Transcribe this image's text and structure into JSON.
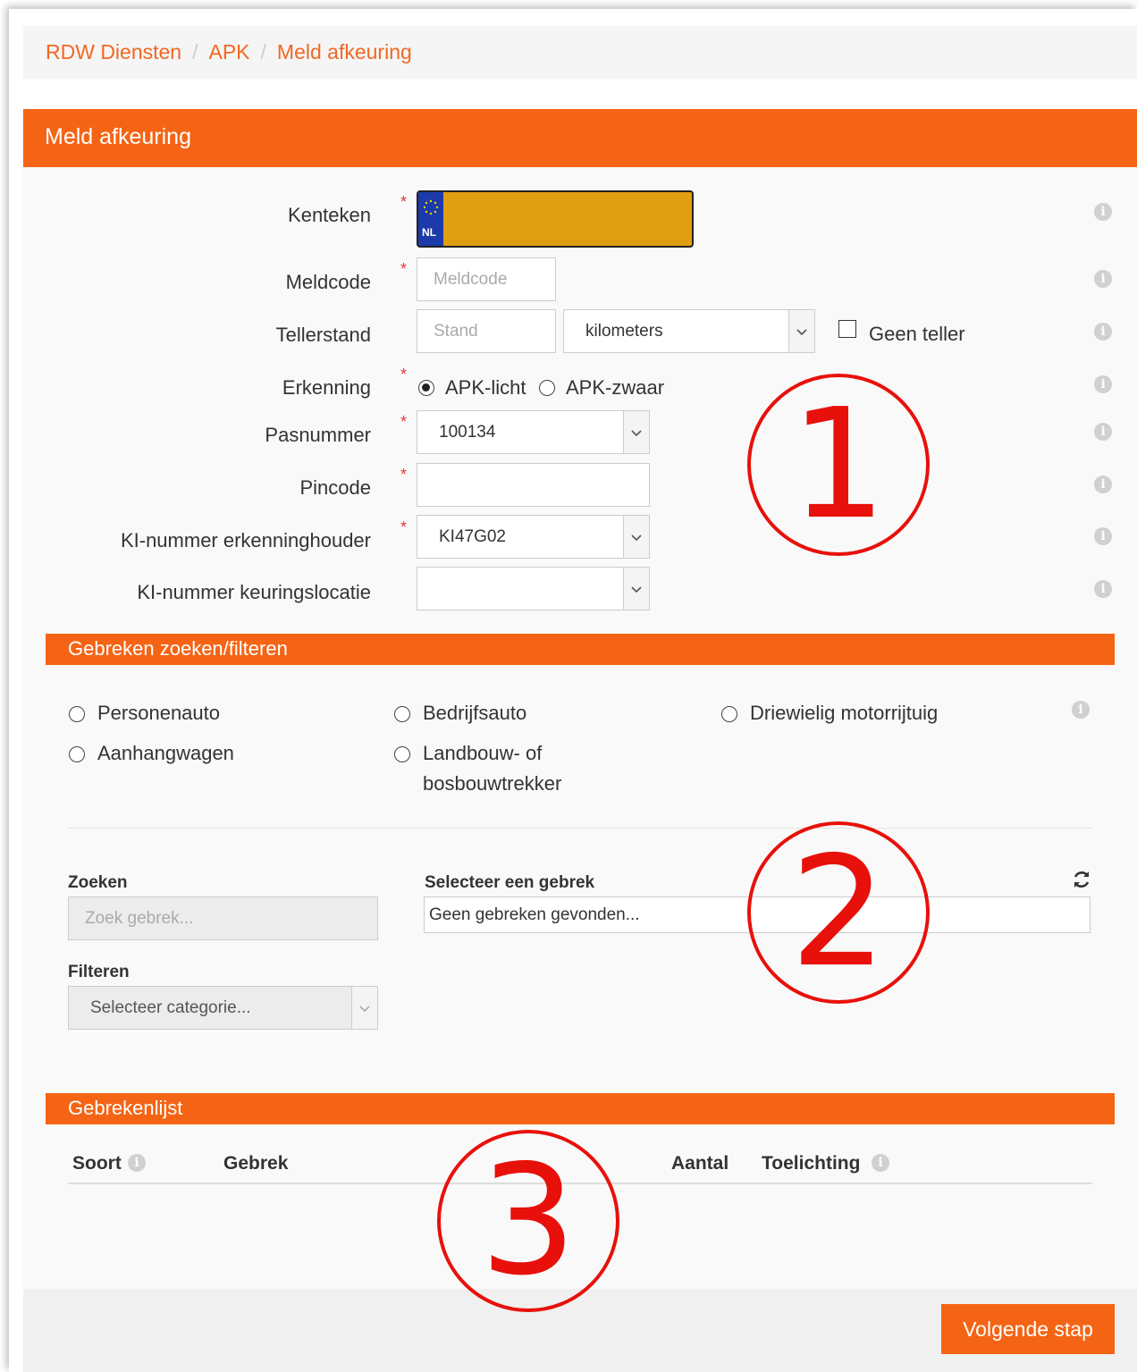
{
  "breadcrumb": {
    "items": [
      "RDW Diensten",
      "APK",
      "Meld afkeuring"
    ],
    "separator": "/"
  },
  "panel": {
    "title": "Meld afkeuring"
  },
  "form": {
    "kenteken_label": "Kenteken",
    "plate_country": "NL",
    "meldcode_label": "Meldcode",
    "meldcode_placeholder": "Meldcode",
    "tellerstand_label": "Tellerstand",
    "tellerstand_placeholder": "Stand",
    "unit_value": "kilometers",
    "geen_teller_label": "Geen teller",
    "erkenning_label": "Erkenning",
    "erkenning_options": [
      "APK-licht",
      "APK-zwaar"
    ],
    "erkenning_selected": "APK-licht",
    "pasnummer_label": "Pasnummer",
    "pasnummer_value": "100134",
    "pincode_label": "Pincode",
    "kinr_erkenninghouder_label": "KI-nummer erkenninghouder",
    "kinr_erkenninghouder_value": "KI47G02",
    "kinr_keuringslocatie_label": "KI-nummer keuringslocatie",
    "required_marker": "*"
  },
  "gebreken": {
    "title": "Gebreken zoeken/filteren",
    "vehicle_types": [
      "Personenauto",
      "Bedrijfsauto",
      "Driewielig motorrijtuig",
      "Aanhangwagen",
      "Landbouw- of",
      "bosbouwtrekker"
    ],
    "zoeken_label": "Zoeken",
    "zoeken_placeholder": "Zoek gebrek...",
    "selecteer_label": "Selecteer een gebrek",
    "selecteer_value": "Geen gebreken gevonden...",
    "filteren_label": "Filteren",
    "filteren_value": "Selecteer categorie..."
  },
  "lijst": {
    "title": "Gebrekenlijst",
    "columns": [
      "Soort",
      "Gebrek",
      "Aantal",
      "Toelichting"
    ]
  },
  "annotations": [
    "①",
    "②",
    "③"
  ],
  "footer": {
    "next_button": "Volgende stap"
  },
  "colors": {
    "accent": "#f56415",
    "link": "#f26722",
    "plate": "#e09f10",
    "annotation": "#e8100b"
  }
}
